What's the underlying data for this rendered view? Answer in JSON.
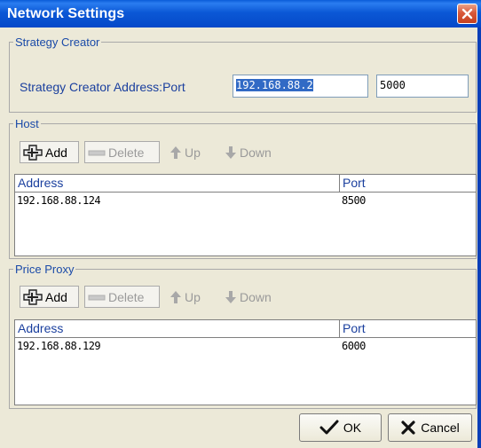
{
  "window": {
    "title": "Network Settings"
  },
  "strategy_creator": {
    "legend": "Strategy Creator",
    "address_label": "Strategy Creator Address:Port",
    "address_value": "192.168.88.2",
    "port_value": "5000"
  },
  "host": {
    "legend": "Host",
    "toolbar": {
      "add": "Add",
      "delete": "Delete",
      "up": "Up",
      "down": "Down"
    },
    "columns": [
      "Address",
      "Port"
    ],
    "rows": [
      {
        "address": "192.168.88.124",
        "port": "8500"
      }
    ]
  },
  "price_proxy": {
    "legend": "Price Proxy",
    "toolbar": {
      "add": "Add",
      "delete": "Delete",
      "up": "Up",
      "down": "Down"
    },
    "columns": [
      "Address",
      "Port"
    ],
    "rows": [
      {
        "address": "192.168.88.129",
        "port": "6000"
      }
    ]
  },
  "footer": {
    "ok": "OK",
    "cancel": "Cancel"
  },
  "colors": {
    "title_bar": "#0b58d6",
    "selection": "#316ac5",
    "label_text": "#1a3f9e"
  }
}
